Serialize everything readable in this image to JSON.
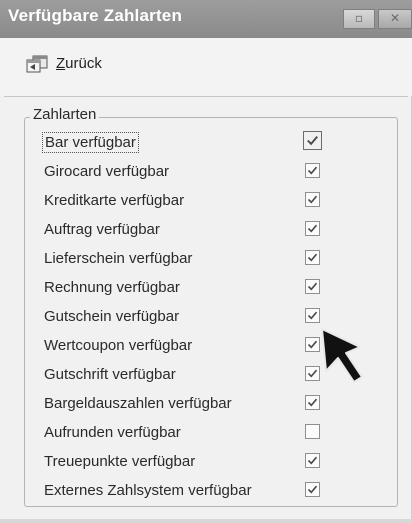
{
  "window": {
    "title": "Verfügbare Zahlarten",
    "minmax_glyph": "▫",
    "close_glyph": "✕"
  },
  "toolbar": {
    "back_label_first": "Z",
    "back_label_rest": "urück",
    "back_icon": "back-window-icon"
  },
  "group": {
    "legend": "Zahlarten"
  },
  "options": [
    {
      "label": "Bar verfügbar",
      "checked": true
    },
    {
      "label": "Girocard verfügbar",
      "checked": true
    },
    {
      "label": "Kreditkarte verfügbar",
      "checked": true
    },
    {
      "label": "Auftrag verfügbar",
      "checked": true
    },
    {
      "label": "Lieferschein verfügbar",
      "checked": true
    },
    {
      "label": "Rechnung verfügbar",
      "checked": true
    },
    {
      "label": "Gutschein verfügbar",
      "checked": true
    },
    {
      "label": "Wertcoupon verfügbar",
      "checked": true
    },
    {
      "label": "Gutschrift verfügbar",
      "checked": true
    },
    {
      "label": "Bargeldauszahlen verfügbar",
      "checked": true
    },
    {
      "label": "Aufrunden verfügbar",
      "checked": false
    },
    {
      "label": "Treuepunkte verfügbar",
      "checked": true
    },
    {
      "label": "Externes Zahlsystem verfügbar",
      "checked": true
    }
  ],
  "colors": {
    "titlebar": "#8f8f8f",
    "window_bg": "#f1f1f1",
    "checkmark": "#4a4a4a"
  }
}
